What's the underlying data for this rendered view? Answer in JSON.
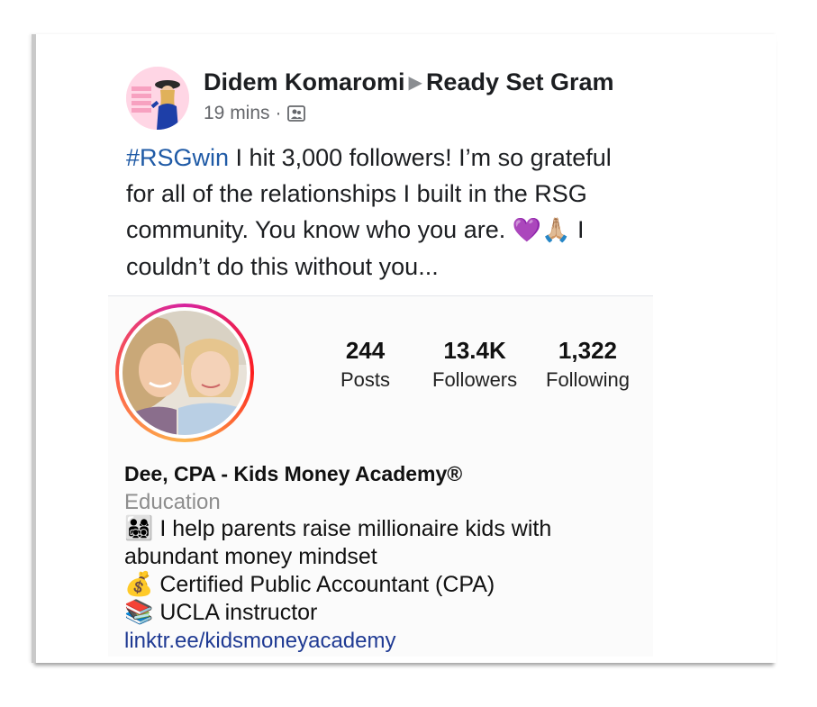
{
  "post": {
    "author": "Didem Komaromi",
    "group": "Ready Set Gram",
    "time": "19 mins",
    "separator": "·",
    "hashtag": "#RSGwin",
    "text_line1": " I hit 3,000 followers! I’m so grateful",
    "text_line2": "for all of the relationships I built in the RSG",
    "text_line3": "community. You know who you are. ",
    "emoji_heart": "💜",
    "emoji_pray": "🙏🏼",
    "text_line3_end": " I",
    "text_line4": "couldn’t do this without you..."
  },
  "profile": {
    "stats": [
      {
        "value": "244",
        "label": "Posts"
      },
      {
        "value": "13.4K",
        "label": "Followers"
      },
      {
        "value": "1,322",
        "label": "Following"
      }
    ],
    "name": "Dee, CPA - Kids Money Academy®",
    "category": "Education",
    "bio_line1_emoji": "👨‍👩‍👧‍👦",
    "bio_line1": " I help parents raise millionaire kids with",
    "bio_line2": "abundant money mindset",
    "bio_line3_emoji": "💰",
    "bio_line3": " Certified Public Accountant (CPA)",
    "bio_line4_emoji": "📚",
    "bio_line4": "  UCLA instructor",
    "link": "linktr.ee/kidsmoneyacademy"
  },
  "colors": {
    "hashtag": "#1f5aa6",
    "link": "#1f3a93",
    "category": "#8e8e8e",
    "meta": "#65676b"
  },
  "icons": {
    "group_arrow": "triangle-right-icon",
    "audience": "group-audience-icon"
  }
}
